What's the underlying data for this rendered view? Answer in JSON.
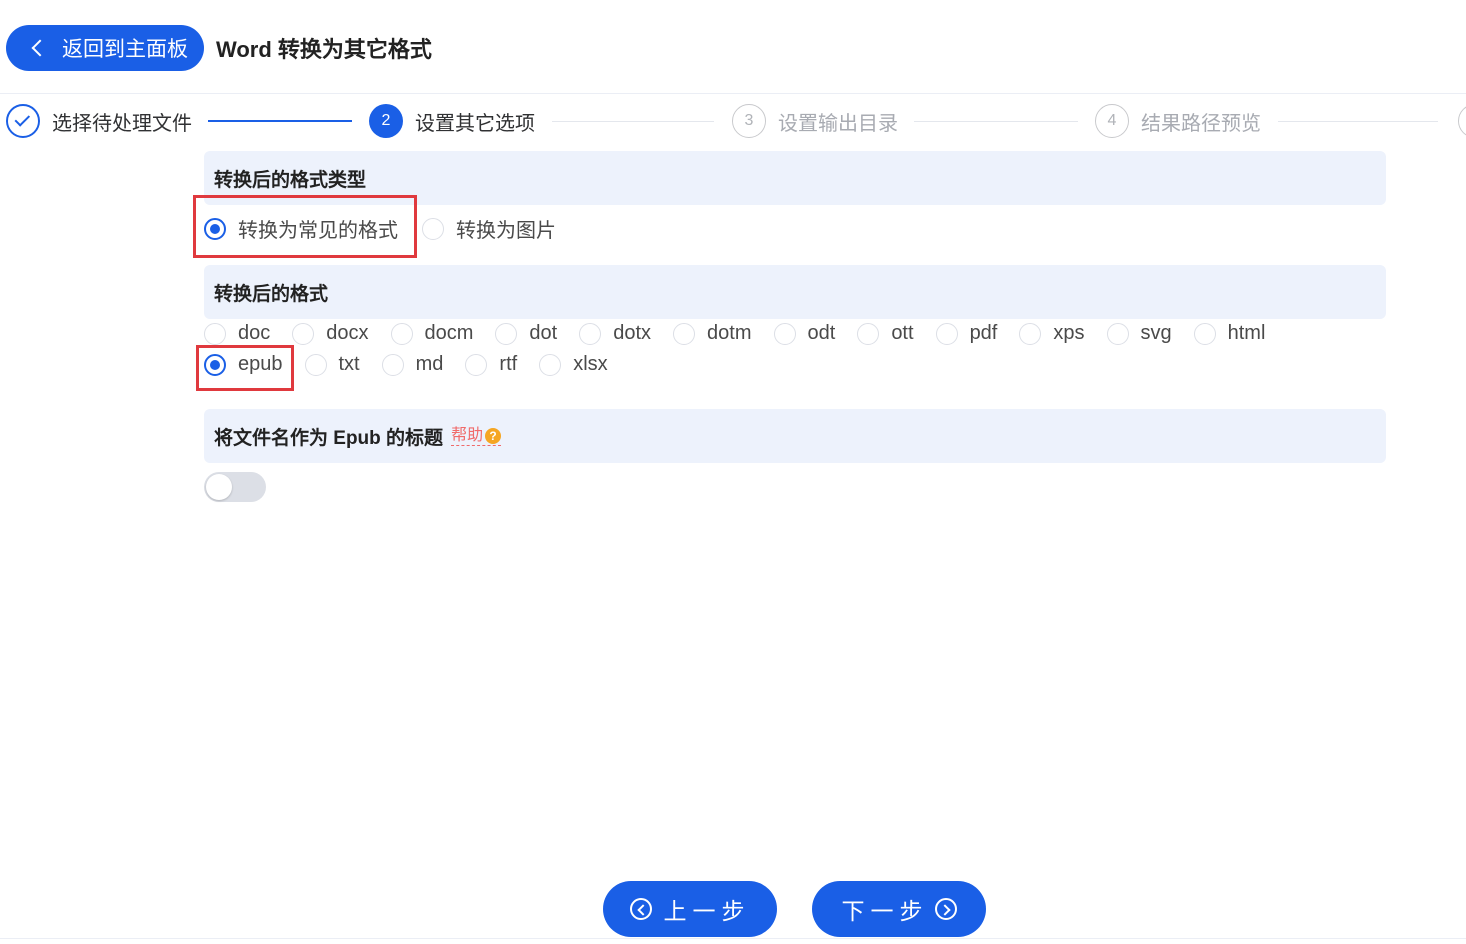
{
  "header": {
    "back_label": "返回到主面板",
    "title": "Word 转换为其它格式"
  },
  "steps": [
    {
      "number": "",
      "label": "选择待处理文件",
      "state": "done"
    },
    {
      "number": "2",
      "label": "设置其它选项",
      "state": "active"
    },
    {
      "number": "3",
      "label": "设置输出目录",
      "state": "todo"
    },
    {
      "number": "4",
      "label": "结果路径预览",
      "state": "todo"
    }
  ],
  "format_type": {
    "heading": "转换后的格式类型",
    "options": [
      {
        "label": "转换为常见的格式",
        "selected": true
      },
      {
        "label": "转换为图片",
        "selected": false
      }
    ]
  },
  "format": {
    "heading": "转换后的格式",
    "row1": [
      "doc",
      "docx",
      "docm",
      "dot",
      "dotx",
      "dotm",
      "odt",
      "ott",
      "pdf",
      "xps",
      "svg",
      "html"
    ],
    "row2": [
      "epub",
      "txt",
      "md",
      "rtf",
      "xlsx"
    ],
    "selected": "epub"
  },
  "epub_title": {
    "heading": "将文件名作为 Epub 的标题",
    "help_label": "帮助",
    "help_icon": "?",
    "toggle_on": false
  },
  "footer": {
    "prev_label": "上一步",
    "next_label": "下一步"
  },
  "colors": {
    "accent": "#1a5fe6",
    "highlight": "#e0393e",
    "section_bg": "#edf2fc"
  }
}
